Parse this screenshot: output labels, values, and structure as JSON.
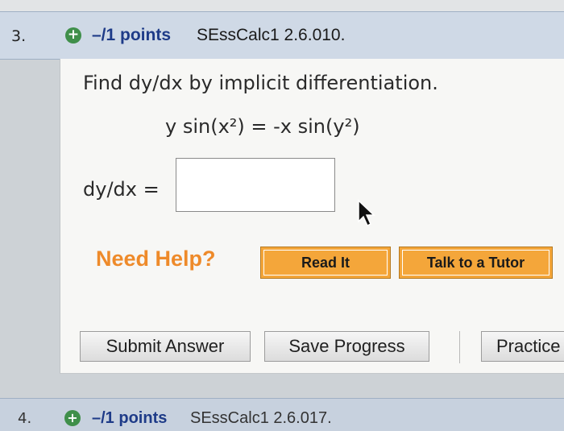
{
  "question": {
    "number": "3.",
    "points": "–/1 points",
    "code": "SEssCalc1 2.6.010.",
    "prompt": "Find dy/dx by implicit differentiation.",
    "equation": "y sin(x²) = -x sin(y²)",
    "answer_label": "dy/dx =",
    "answer_value": ""
  },
  "help": {
    "label": "Need Help?",
    "read_it": "Read It",
    "tutor": "Talk to a Tutor"
  },
  "actions": {
    "submit": "Submit Answer",
    "save": "Save Progress",
    "practice": "Practice"
  },
  "next_question": {
    "number": "4.",
    "points": "–/1 points",
    "code": "SEssCalc1 2.6.017."
  },
  "colors": {
    "header_bg": "#cfd9e6",
    "points_text": "#1e3b88",
    "need_help": "#ee8a2a",
    "help_button": "#f4a63a",
    "plus_icon": "#3f8f4a"
  },
  "icons": [
    "plus-circle-icon",
    "mouse-cursor-icon"
  ]
}
